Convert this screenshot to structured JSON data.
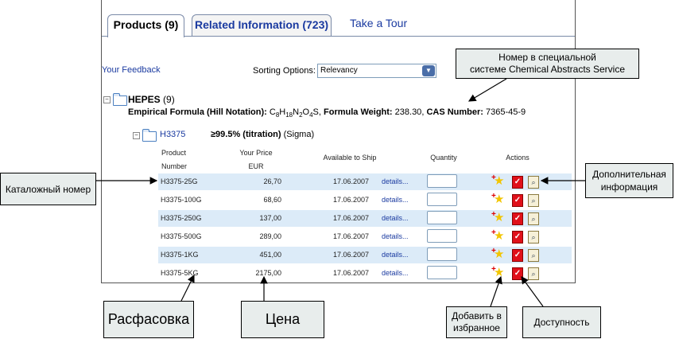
{
  "tabs": {
    "products": "Products (9)",
    "related": "Related Information (723)",
    "tour": "Take a Tour"
  },
  "feedback": "Your Feedback",
  "sorting": {
    "label": "Sorting Options:",
    "value": "Relevancy"
  },
  "group": {
    "name": "HEPES",
    "count": "(9)",
    "formula_label": "Empirical Formula (Hill Notation):",
    "formula": "C8H18N2O4S",
    "weight_label": "Formula Weight:",
    "weight": "238.30",
    "cas_label": "CAS Number:",
    "cas": "7365-45-9"
  },
  "product": {
    "code": "H3375",
    "purity": "≥99.5% (titration)",
    "brand": "(Sigma)"
  },
  "table": {
    "headers": {
      "number_line1": "Product",
      "number_line2": "Number",
      "price_line1": "Your Price",
      "price_line2": "EUR",
      "available": "Available to Ship",
      "quantity": "Quantity",
      "actions": "Actions"
    },
    "rows": [
      {
        "number": "H3375-25G",
        "price": "26,70",
        "date": "17.06.2007",
        "details": "details..."
      },
      {
        "number": "H3375-100G",
        "price": "68,60",
        "date": "17.06.2007",
        "details": "details..."
      },
      {
        "number": "H3375-250G",
        "price": "137,00",
        "date": "17.06.2007",
        "details": "details..."
      },
      {
        "number": "H3375-500G",
        "price": "289,00",
        "date": "17.06.2007",
        "details": "details..."
      },
      {
        "number": "H3375-1KG",
        "price": "451,00",
        "date": "17.06.2007",
        "details": "details..."
      },
      {
        "number": "H3375-5KG",
        "price": "2175,00",
        "date": "17.06.2007",
        "details": "details..."
      }
    ]
  },
  "callouts": {
    "cas_line1": "Номер в специальной",
    "cas_line2": "системе Chemical Abstracts Service",
    "catalog": "Каталожный номер",
    "more_line1": "Дополнительная",
    "more_line2": "информация",
    "packaging": "Расфасовка",
    "price": "Цена",
    "fav_line1": "Добавить в",
    "fav_line2": "избранное",
    "availability": "Доступность"
  },
  "colors": {
    "link": "#1a3aa0",
    "row_shade": "#dcebf8",
    "callout_bg": "#e8edec"
  }
}
